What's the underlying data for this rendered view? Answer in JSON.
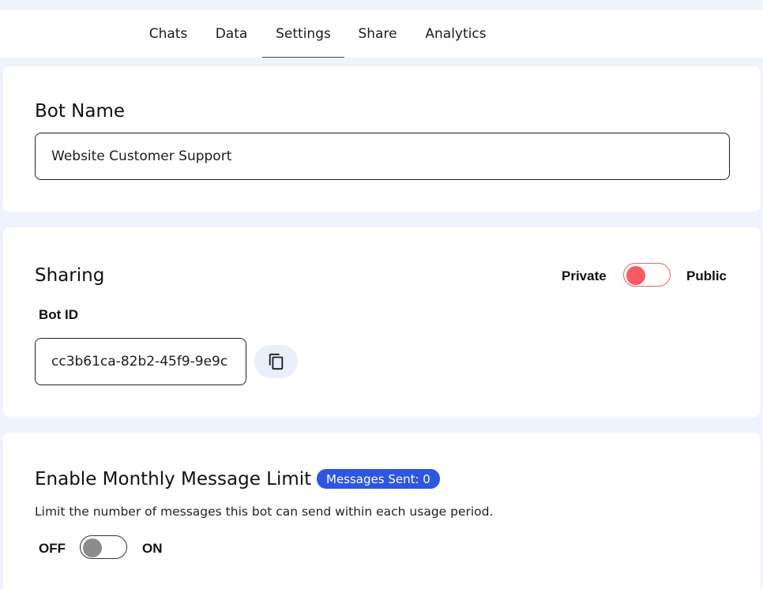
{
  "tabs": [
    {
      "label": "Chats"
    },
    {
      "label": "Data"
    },
    {
      "label": "Settings",
      "active": true
    },
    {
      "label": "Share"
    },
    {
      "label": "Analytics"
    }
  ],
  "bot_name": {
    "title": "Bot Name",
    "value": "Website Customer Support"
  },
  "sharing": {
    "title": "Sharing",
    "private_label": "Private",
    "public_label": "Public",
    "state": "private",
    "bot_id_label": "Bot ID",
    "bot_id_value": "cc3b61ca-82b2-45f9-9e9c",
    "copy_icon": "copy-icon"
  },
  "message_limit": {
    "title": "Enable Monthly Message Limit",
    "badge": "Messages Sent: 0",
    "description": "Limit the number of messages this bot can send within each usage period.",
    "off_label": "OFF",
    "on_label": "ON",
    "state": "off"
  },
  "colors": {
    "accent_blue": "#2f56e0",
    "private_red": "#fa5a64",
    "background": "#eef3fd"
  }
}
